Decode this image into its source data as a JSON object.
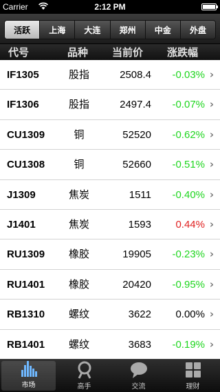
{
  "status_bar": {
    "carrier": "Carrier",
    "time": "2:12 PM"
  },
  "segments": [
    {
      "label": "活跃",
      "active": true
    },
    {
      "label": "上海",
      "active": false
    },
    {
      "label": "大连",
      "active": false
    },
    {
      "label": "郑州",
      "active": false
    },
    {
      "label": "中金",
      "active": false
    },
    {
      "label": "外盘",
      "active": false
    }
  ],
  "columns": {
    "code": "代号",
    "type": "品种",
    "price": "当前价",
    "change": "涨跌幅"
  },
  "colors": {
    "up": "#e02020",
    "down": "#1fd61f",
    "flat": "#000000"
  },
  "rows": [
    {
      "code": "IF1305",
      "type": "股指",
      "price": "2508.4",
      "change": "-0.03%",
      "dir": "down"
    },
    {
      "code": "IF1306",
      "type": "股指",
      "price": "2497.4",
      "change": "-0.07%",
      "dir": "down"
    },
    {
      "code": "CU1309",
      "type": "铜",
      "price": "52520",
      "change": "-0.62%",
      "dir": "down"
    },
    {
      "code": "CU1308",
      "type": "铜",
      "price": "52660",
      "change": "-0.51%",
      "dir": "down"
    },
    {
      "code": "J1309",
      "type": "焦炭",
      "price": "1511",
      "change": "-0.40%",
      "dir": "down"
    },
    {
      "code": "J1401",
      "type": "焦炭",
      "price": "1593",
      "change": "0.44%",
      "dir": "up"
    },
    {
      "code": "RU1309",
      "type": "橡胶",
      "price": "19905",
      "change": "-0.23%",
      "dir": "down"
    },
    {
      "code": "RU1401",
      "type": "橡胶",
      "price": "20420",
      "change": "-0.95%",
      "dir": "down"
    },
    {
      "code": "RB1310",
      "type": "螺纹",
      "price": "3622",
      "change": "0.00%",
      "dir": "flat"
    },
    {
      "code": "RB1401",
      "type": "螺纹",
      "price": "3683",
      "change": "-0.19%",
      "dir": "down"
    }
  ],
  "tabs": [
    {
      "label": "市场",
      "icon": "bar-chart-icon",
      "active": true
    },
    {
      "label": "高手",
      "icon": "person-icon",
      "active": false
    },
    {
      "label": "交流",
      "icon": "speech-bubble-icon",
      "active": false
    },
    {
      "label": "理财",
      "icon": "grid-icon",
      "active": false
    }
  ]
}
